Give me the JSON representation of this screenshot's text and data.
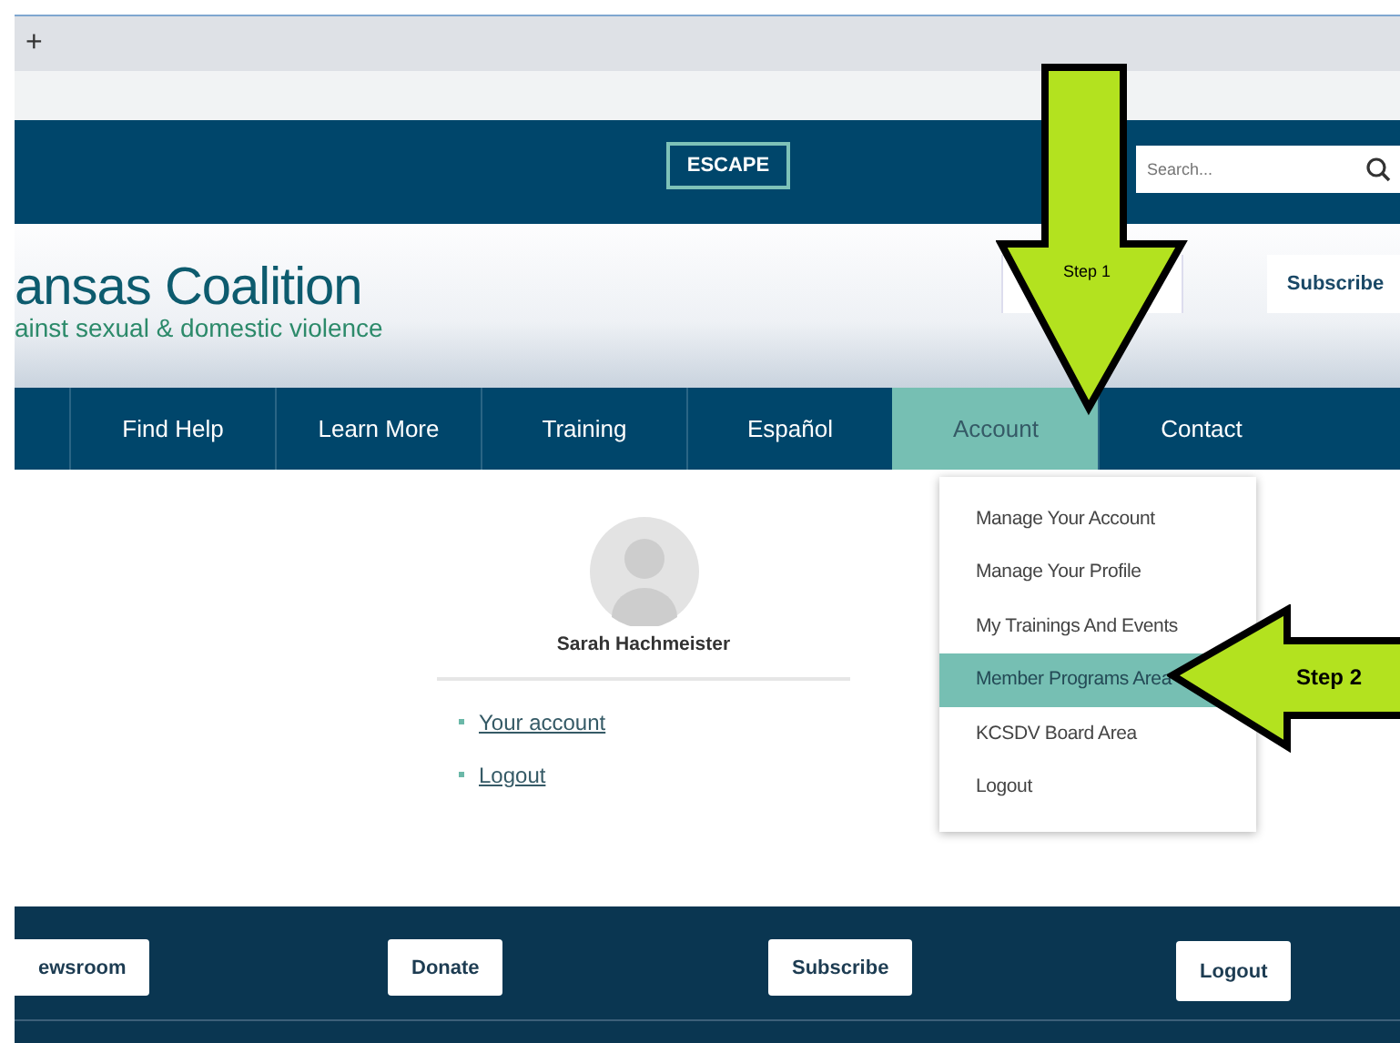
{
  "browser": {
    "new_tab": "+"
  },
  "top_bar": {
    "escape": "ESCAPE",
    "search": {
      "placeholder": "Search..."
    }
  },
  "header": {
    "logo_title": "ansas Coalition",
    "logo_subtitle": "ainst sexual & domestic violence",
    "subscribe": "Subscribe"
  },
  "nav": [
    {
      "label": "Find Help",
      "selected": false
    },
    {
      "label": "Learn More",
      "selected": false
    },
    {
      "label": "Training",
      "selected": false
    },
    {
      "label": "Español",
      "selected": false
    },
    {
      "label": "Account",
      "selected": true
    },
    {
      "label": "Contact",
      "selected": false
    }
  ],
  "account_menu": [
    {
      "label": "Manage Your Account",
      "selected": false
    },
    {
      "label": "Manage Your Profile",
      "selected": false
    },
    {
      "label": "My Trainings And Events",
      "selected": false
    },
    {
      "label": "Member Programs Area",
      "selected": true
    },
    {
      "label": "KCSDV Board Area",
      "selected": false
    },
    {
      "label": "Logout",
      "selected": false
    }
  ],
  "profile": {
    "name": "Sarah Hachmeister",
    "links": [
      "Your account",
      "Logout"
    ]
  },
  "footer": {
    "buttons": [
      "ewsroom",
      "Donate",
      "Subscribe",
      "Logout"
    ]
  },
  "annotations": [
    {
      "kind": "down",
      "label": "Step 1"
    },
    {
      "kind": "left",
      "label": "Step 2"
    }
  ]
}
